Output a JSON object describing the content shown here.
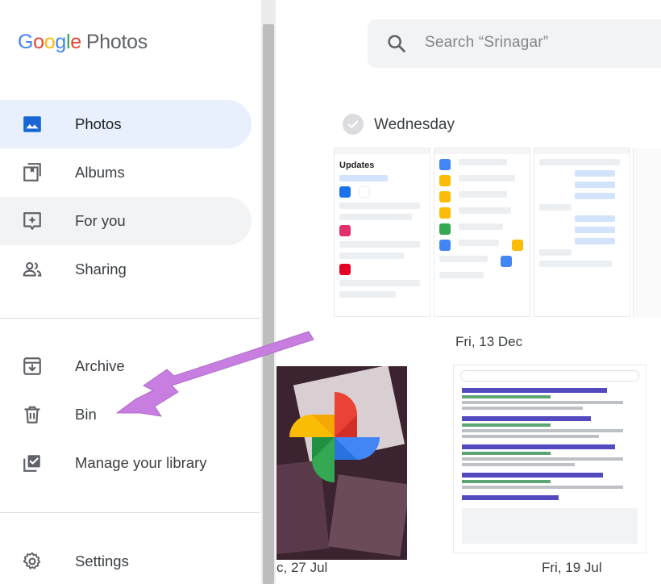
{
  "app": {
    "logo_google": [
      "G",
      "o",
      "o",
      "g",
      "l",
      "e"
    ],
    "logo_product": "Photos"
  },
  "search": {
    "placeholder": "Search “Srinagar”",
    "icon": "search-icon"
  },
  "sidebar": {
    "items": [
      {
        "label": "Photos",
        "icon": "photo-icon",
        "state": "selected"
      },
      {
        "label": "Albums",
        "icon": "albums-icon",
        "state": "normal"
      },
      {
        "label": "For you",
        "icon": "for-you-icon",
        "state": "hover"
      },
      {
        "label": "Sharing",
        "icon": "people-icon",
        "state": "normal"
      },
      {
        "label": "Archive",
        "icon": "archive-icon",
        "state": "normal"
      },
      {
        "label": "Bin",
        "icon": "trash-icon",
        "state": "normal"
      },
      {
        "label": "Manage your library",
        "icon": "manage-library-icon",
        "state": "normal"
      },
      {
        "label": "Settings",
        "icon": "gear-icon",
        "state": "normal"
      }
    ]
  },
  "photos_grid": {
    "dates": [
      "Wednesday",
      "Fri, 13 Dec",
      "c, 27 Jul",
      "Fri, 19 Jul"
    ],
    "thumb_text": {
      "updates": "Updates"
    }
  },
  "colors": {
    "selected_bg": "#e8f0fe",
    "hover_bg": "#f1f3f4",
    "icon_gray": "#5f6368",
    "photos_icon_blue": "#1967d2",
    "annotation_arrow": "#c77ee0",
    "google_blue": "#4285f4",
    "google_red": "#ea4335",
    "google_yellow": "#fbbc05",
    "google_green": "#34a853"
  }
}
